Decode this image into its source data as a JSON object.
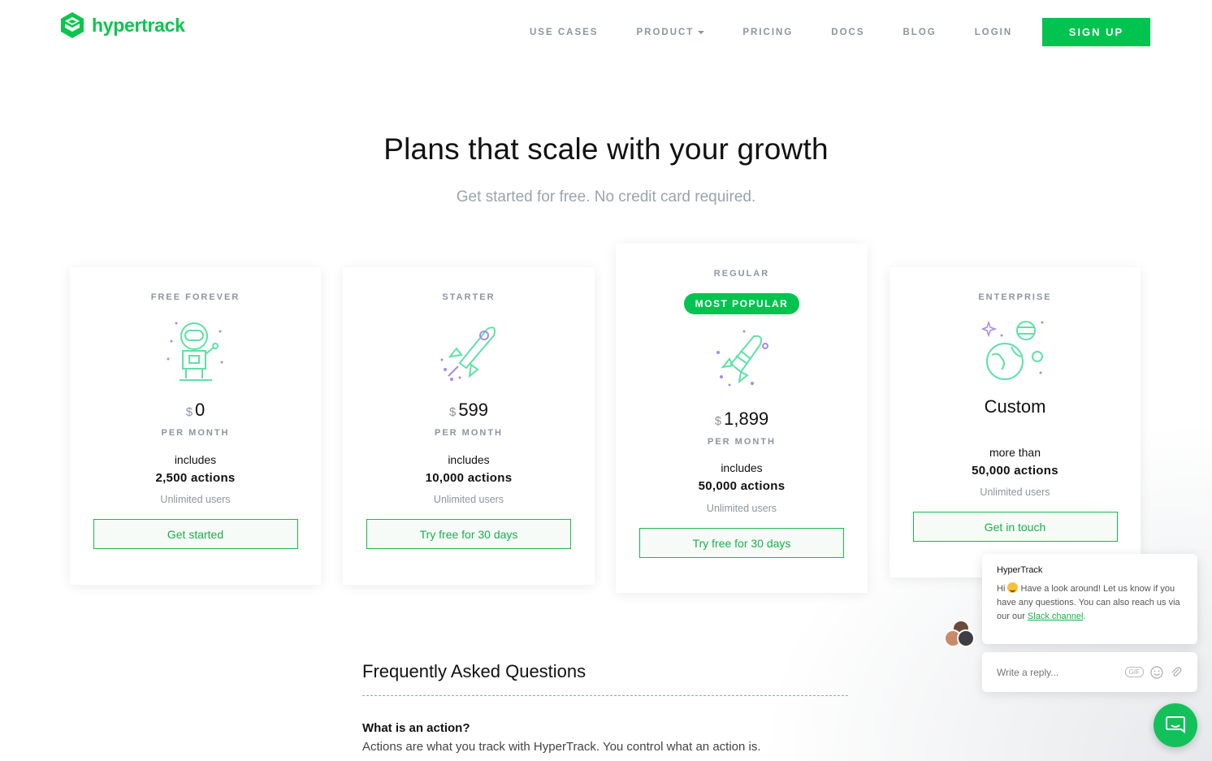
{
  "brand": {
    "name": "hypertrack",
    "accent": "#00c44f",
    "icon": "hypertrack-logo-icon"
  },
  "nav": {
    "items": [
      "USE CASES",
      "PRODUCT",
      "PRICING",
      "DOCS",
      "BLOG",
      "LOGIN"
    ],
    "signup_label": "SIGN UP"
  },
  "hero": {
    "title": "Plans that scale with your growth",
    "subtitle": "Get started for free. No credit card required."
  },
  "plans": [
    {
      "name": "FREE FOREVER",
      "icon": "astronaut-icon",
      "currency": "$",
      "price": "0",
      "per": "PER MONTH",
      "includes": "includes",
      "actions": "2,500 actions",
      "users": "Unlimited users",
      "cta": "Get started"
    },
    {
      "name": "STARTER",
      "icon": "rocket-icon",
      "currency": "$",
      "price": "599",
      "per": "PER MONTH",
      "includes": "includes",
      "actions": "10,000 actions",
      "users": "Unlimited users",
      "cta": "Try free for 30 days"
    },
    {
      "name": "REGULAR",
      "badge": "MOST POPULAR",
      "icon": "space-shuttle-icon",
      "currency": "$",
      "price": "1,899",
      "per": "PER MONTH",
      "includes": "includes",
      "actions": "50,000 actions",
      "users": "Unlimited users",
      "cta": "Try free for 30 days"
    },
    {
      "name": "ENTERPRISE",
      "icon": "planets-icon",
      "price_text": "Custom",
      "includes": "more than",
      "actions": "50,000 actions",
      "users": "Unlimited users",
      "cta": "Get in touch"
    }
  ],
  "faq": {
    "title": "Frequently Asked Questions",
    "q1": "What is an action?",
    "a1": "Actions are what you track with HyperTrack. You control what an action is."
  },
  "chat": {
    "from": "HyperTrack",
    "msg_hi": "Hi",
    "msg_body": "Have a look around! Let us know if you have any questions. You can also reach us via our our",
    "link": "Slack channel",
    "msg_end": ".",
    "reply_placeholder": "Write a reply...",
    "gif_label": "GIF"
  }
}
